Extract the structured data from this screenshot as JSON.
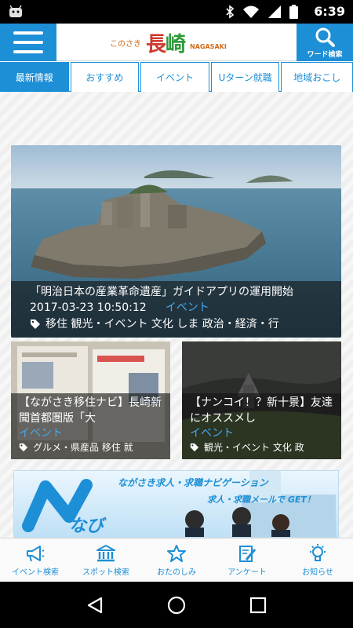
{
  "status_bar": {
    "time": "6:39"
  },
  "header": {
    "logo_small": "このさき",
    "logo_big_1": "長",
    "logo_big_2": "崎",
    "logo_roman": "NAGASAKI",
    "search_label": "ワード検索"
  },
  "tabs": [
    {
      "label": "最新情報",
      "active": true
    },
    {
      "label": "おすすめ",
      "active": false
    },
    {
      "label": "イベント",
      "active": false
    },
    {
      "label": "Uターン就職",
      "active": false
    },
    {
      "label": "地域おこし",
      "active": false
    }
  ],
  "featured": {
    "title": "「明治日本の産業革命遺産」ガイドアプリの運用開始",
    "date": "2017-03-23 10:50:12",
    "category": "イベント",
    "tags": "移住 観光・イベント 文化 しま 政治・経済・行"
  },
  "cards": [
    {
      "title": "【ながさき移住ナビ】長崎新聞首都圏版「大",
      "category": "イベント",
      "tags": "グルメ・県産品 移住 就"
    },
    {
      "title": "【ナンコイ！？新十景】友達にオススメし",
      "category": "イベント",
      "tags": "観光・イベント 文化 政"
    }
  ],
  "banner": {
    "logo_text": "なび",
    "line1": "ながさき求人・求職ナビゲーション",
    "line2": "求人・求職メールで GET！"
  },
  "bottom_nav": [
    {
      "label": "イベント検索",
      "icon": "megaphone-icon"
    },
    {
      "label": "スポット検索",
      "icon": "building-icon"
    },
    {
      "label": "おたのしみ",
      "icon": "star-icon"
    },
    {
      "label": "アンケート",
      "icon": "pencil-note-icon"
    },
    {
      "label": "お知らせ",
      "icon": "bulb-icon"
    }
  ],
  "colors": {
    "accent": "#1d8fd6",
    "category": "#46a9ec"
  }
}
